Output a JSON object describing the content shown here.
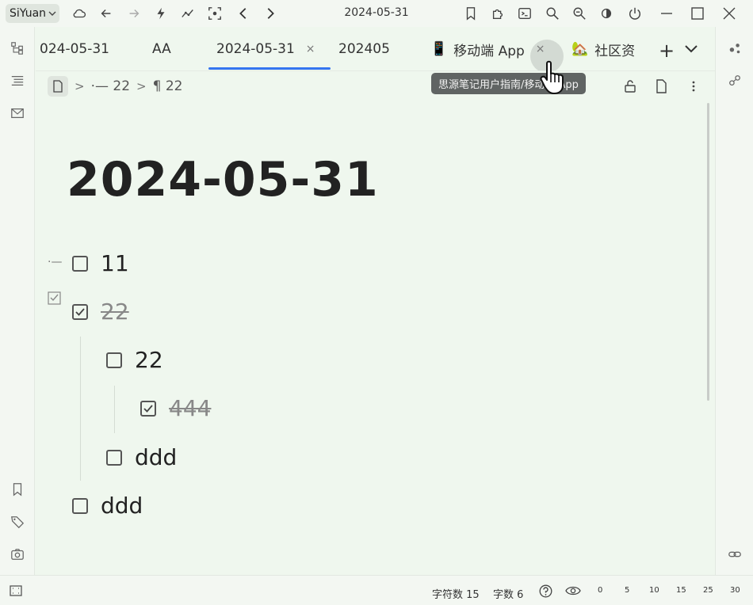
{
  "app": {
    "name": "SiYuan",
    "title": "2024-05-31"
  },
  "tabs": [
    {
      "label": "024-05-31"
    },
    {
      "label": "AA"
    },
    {
      "label": "2024-05-31",
      "close": "×"
    },
    {
      "label": "202405"
    },
    {
      "emoji": "📱",
      "label": "移动端 App",
      "close": "×"
    },
    {
      "emoji": "🏡",
      "label": "社区资"
    }
  ],
  "tab_plus": "+",
  "tooltip": "思源笔记用户指南/移动端 App",
  "breadcrumb": {
    "sep": ">",
    "item1": "⋅— 22",
    "item2": "¶ 22"
  },
  "doc": {
    "title": "2024-05-31",
    "tasks": [
      {
        "text": "11",
        "checked": false
      },
      {
        "text": "22",
        "checked": true
      },
      {
        "text": "22",
        "checked": false
      },
      {
        "text": "444",
        "checked": true
      },
      {
        "text": "ddd",
        "checked": false
      },
      {
        "text": "ddd",
        "checked": false
      }
    ]
  },
  "status": {
    "chars": "字符数 15",
    "words": "字数 6",
    "zoom_marks": [
      "0",
      "5",
      "10",
      "15",
      "25",
      "30"
    ]
  },
  "colors": {
    "accent": "#3575f0",
    "background": "#eff7ee"
  }
}
